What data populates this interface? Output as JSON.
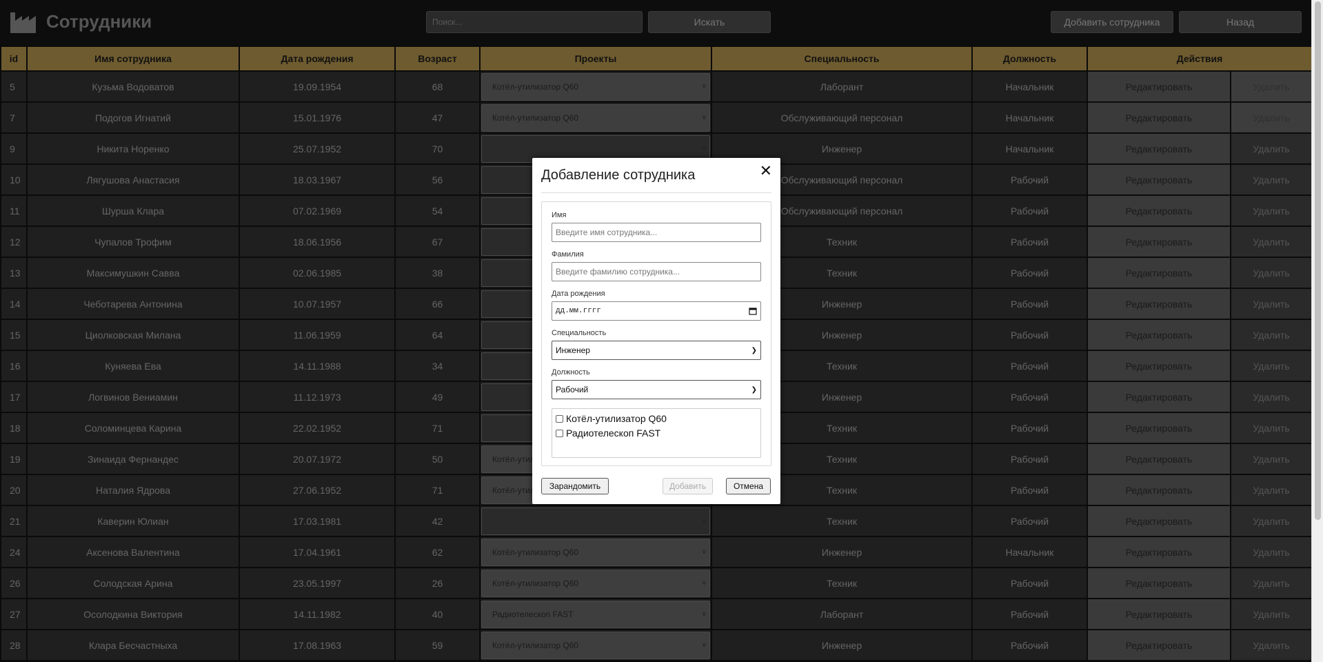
{
  "header": {
    "title": "Сотрудники",
    "search_placeholder": "Поиск...",
    "search_button": "Искать",
    "add_button": "Добавить сотрудника",
    "back_button": "Назад"
  },
  "table": {
    "columns": [
      "id",
      "Имя сотрудника",
      "Дата рождения",
      "Возраст",
      "Проекты",
      "Специальность",
      "Должность",
      "Действия"
    ],
    "edit_label": "Редактировать",
    "delete_label": "Удалить",
    "rows": [
      {
        "id": "5",
        "name": "Кузьма Водоватов",
        "birth": "19.09.1954",
        "age": "68",
        "project": "Котёл-утилизатор Q60",
        "specialty": "Лаборант",
        "position": "Начальник",
        "delete_disabled": true
      },
      {
        "id": "7",
        "name": "Подогов Игнатий",
        "birth": "15.01.1976",
        "age": "47",
        "project": "Котёл-утилизатор Q60",
        "specialty": "Обслуживающий персонал",
        "position": "Начальник",
        "delete_disabled": true
      },
      {
        "id": "9",
        "name": "Никита Норенко",
        "birth": "25.07.1952",
        "age": "70",
        "project": "",
        "specialty": "Инженер",
        "position": "Начальник",
        "delete_disabled": false
      },
      {
        "id": "10",
        "name": "Лягушова Анастасия",
        "birth": "18.03.1967",
        "age": "56",
        "project": "",
        "specialty": "Обслуживающий персонал",
        "position": "Рабочий",
        "delete_disabled": false
      },
      {
        "id": "11",
        "name": "Шурша Клара",
        "birth": "07.02.1969",
        "age": "54",
        "project": "",
        "specialty": "Обслуживающий персонал",
        "position": "Рабочий",
        "delete_disabled": false
      },
      {
        "id": "12",
        "name": "Чупалов Трофим",
        "birth": "18.06.1956",
        "age": "67",
        "project": "",
        "specialty": "Техник",
        "position": "Рабочий",
        "delete_disabled": false
      },
      {
        "id": "13",
        "name": "Максимушкин Савва",
        "birth": "02.06.1985",
        "age": "38",
        "project": "",
        "specialty": "Техник",
        "position": "Рабочий",
        "delete_disabled": false
      },
      {
        "id": "14",
        "name": "Чеботарева Антонина",
        "birth": "10.07.1957",
        "age": "66",
        "project": "",
        "specialty": "Инженер",
        "position": "Рабочий",
        "delete_disabled": false
      },
      {
        "id": "15",
        "name": "Циолковская Милана",
        "birth": "11.06.1959",
        "age": "64",
        "project": "",
        "specialty": "Инженер",
        "position": "Рабочий",
        "delete_disabled": false
      },
      {
        "id": "16",
        "name": "Куняева Ева",
        "birth": "14.11.1988",
        "age": "34",
        "project": "",
        "specialty": "Техник",
        "position": "Рабочий",
        "delete_disabled": false
      },
      {
        "id": "17",
        "name": "Логвинов Вениамин",
        "birth": "11.12.1973",
        "age": "49",
        "project": "",
        "specialty": "Инженер",
        "position": "Рабочий",
        "delete_disabled": false
      },
      {
        "id": "18",
        "name": "Соломинцева Карина",
        "birth": "22.02.1952",
        "age": "71",
        "project": "",
        "specialty": "Техник",
        "position": "Рабочий",
        "delete_disabled": false
      },
      {
        "id": "19",
        "name": "Зинаида Фернандес",
        "birth": "20.07.1972",
        "age": "50",
        "project": "Котёл-утил",
        "specialty": "Техник",
        "position": "Рабочий",
        "delete_disabled": false
      },
      {
        "id": "20",
        "name": "Наталия Ядрова",
        "birth": "27.06.1952",
        "age": "71",
        "project": "Котёл-утил",
        "specialty": "Техник",
        "position": "Рабочий",
        "delete_disabled": false
      },
      {
        "id": "21",
        "name": "Каверин Юлиан",
        "birth": "17.03.1981",
        "age": "42",
        "project": "",
        "specialty": "Техник",
        "position": "Рабочий",
        "delete_disabled": false
      },
      {
        "id": "24",
        "name": "Аксенова Валентина",
        "birth": "17.04.1961",
        "age": "62",
        "project": "Котёл-утилизатор Q60",
        "specialty": "Инженер",
        "position": "Начальник",
        "delete_disabled": false
      },
      {
        "id": "26",
        "name": "Солодская Арина",
        "birth": "23.05.1997",
        "age": "26",
        "project": "Котёл-утилизатор Q60",
        "specialty": "Техник",
        "position": "Рабочий",
        "delete_disabled": false
      },
      {
        "id": "27",
        "name": "Осолодкина Виктория",
        "birth": "14.11.1982",
        "age": "40",
        "project": "Радиотелескоп FAST",
        "specialty": "Лаборант",
        "position": "Рабочий",
        "delete_disabled": false
      },
      {
        "id": "28",
        "name": "Клара Бесчастныха",
        "birth": "17.08.1963",
        "age": "59",
        "project": "Котёл-утилизатор Q60",
        "specialty": "Инженер",
        "position": "Рабочий",
        "delete_disabled": false
      }
    ]
  },
  "modal": {
    "title": "Добавление сотрудника",
    "close_glyph": "✕",
    "name_label": "Имя",
    "name_placeholder": "Введите имя сотрудника...",
    "surname_label": "Фамилия",
    "surname_placeholder": "Введите фамилию сотрудника...",
    "birth_label": "Дата рождения",
    "birth_placeholder": "дд.мм.гггг",
    "specialty_label": "Специальность",
    "specialty_value": "Инженер",
    "position_label": "Должность",
    "position_value": "Рабочий",
    "projects": [
      "Котёл-утилизатор Q60",
      "Радиотелескоп FAST"
    ],
    "randomize_button": "Зарандомить",
    "add_button": "Добавить",
    "cancel_button": "Отмена"
  },
  "colors": {
    "header_row": "#6e5b2f",
    "page_bg": "#0b0b0b",
    "cell_bg": "#1f1f1f"
  },
  "icons": {
    "brand": "factory-icon",
    "close": "close-icon",
    "calendar": "calendar-icon",
    "dropdown": "chevron-down-icon"
  }
}
